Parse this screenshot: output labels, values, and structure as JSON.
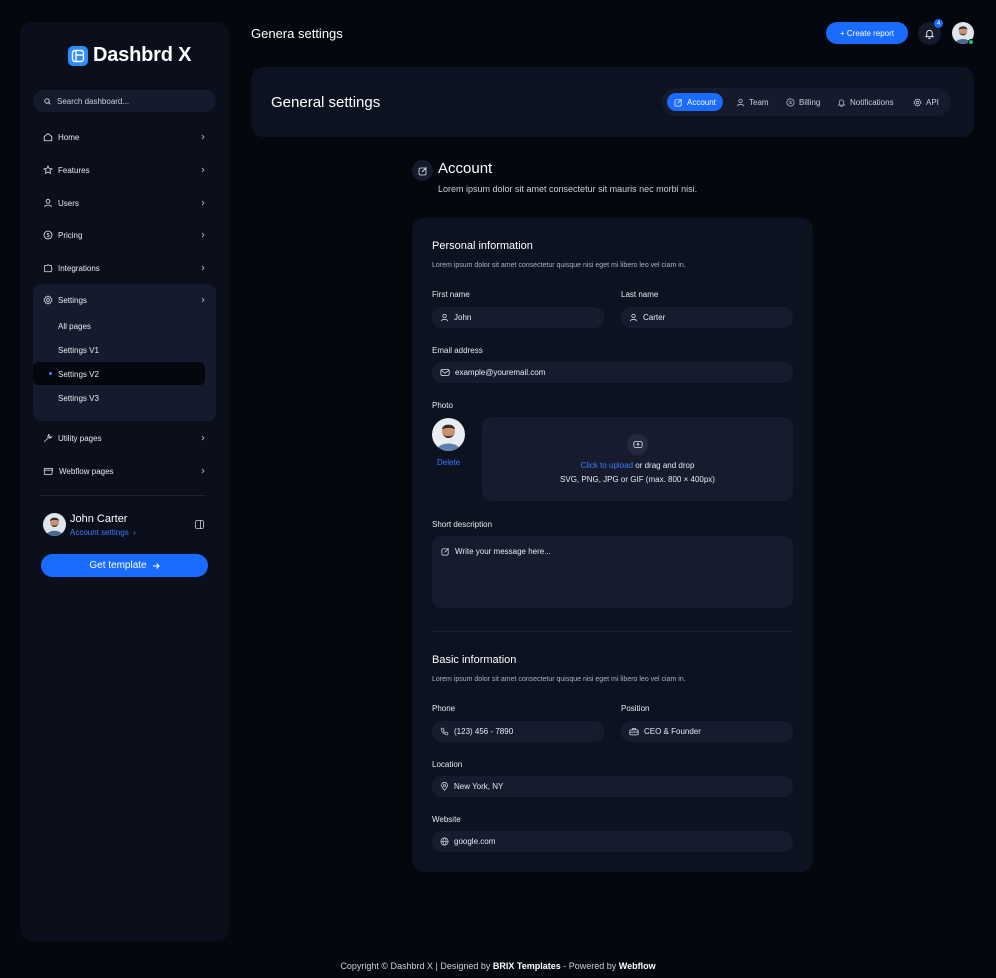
{
  "sidebar": {
    "logo_text": "Dashbrd X",
    "search_placeholder": "Search dashboard...",
    "items": [
      {
        "label": "Home",
        "icon": "home-icon"
      },
      {
        "label": "Features",
        "icon": "star-icon"
      },
      {
        "label": "Users",
        "icon": "user-icon"
      },
      {
        "label": "Pricing",
        "icon": "dollar-icon"
      },
      {
        "label": "Integrations",
        "icon": "puzzle-icon"
      },
      {
        "label": "Settings",
        "icon": "gear-icon"
      }
    ],
    "settings_sub": [
      "All pages",
      "Settings V1",
      "Settings V2",
      "Settings V3"
    ],
    "active_sub": "Settings V2",
    "more_items": [
      {
        "label": "Utility pages",
        "icon": "wrench-icon"
      },
      {
        "label": "Webflow pages",
        "icon": "browser-icon"
      }
    ],
    "profile": {
      "name": "John Carter",
      "link": "Account settings"
    },
    "cta": "Get template"
  },
  "topbar": {
    "title": "Genera settings",
    "create_label": "+ Create report",
    "notification_count": "4"
  },
  "header": {
    "title": "General settings",
    "tabs": [
      {
        "label": "Account",
        "icon": "edit-icon",
        "active": true
      },
      {
        "label": "Team",
        "icon": "user-icon",
        "active": false
      },
      {
        "label": "Billing",
        "icon": "dollar-icon",
        "active": false
      },
      {
        "label": "Notifications",
        "icon": "bell-icon",
        "active": false
      },
      {
        "label": "API",
        "icon": "gear-icon",
        "active": false
      }
    ]
  },
  "account": {
    "title": "Account",
    "description": "Lorem ipsum dolor sit amet consectetur sit mauris nec morbi nisi."
  },
  "personal": {
    "title": "Personal information",
    "description": "Lorem ipsum dolor sit amet consectetur quisque nisi eget mi libero leo vel ciam in.",
    "first_name_label": "First name",
    "first_name_value": "John",
    "last_name_label": "Last name",
    "last_name_value": "Carter",
    "email_label": "Email address",
    "email_placeholder": "example@youremail.com",
    "photo_label": "Photo",
    "delete_label": "Delete",
    "upload_link": "Click to upload",
    "upload_rest": " or drag and drop",
    "upload_hint": "SVG, PNG, JPG or GIF (max. 800 × 400px)",
    "short_desc_label": "Short description",
    "short_desc_placeholder": "Write your message here..."
  },
  "basic": {
    "title": "Basic information",
    "description": "Lorem ipsum dolor sit amet consectetur quisque nisi eget mi libero leo vel ciam in.",
    "phone_label": "Phone",
    "phone_value": "(123) 456 - 7890",
    "position_label": "Position",
    "position_value": "CEO  & Founder",
    "location_label": "Location",
    "location_value": "New York, NY",
    "website_label": "Website",
    "website_value": "google.com"
  },
  "footer": {
    "prefix": "Copyright © Dashbrd X | Designed by ",
    "brix": "BRIX Templates",
    "mid": " - Powered by ",
    "webflow": "Webflow"
  },
  "colors": {
    "accent": "#1a6bff",
    "background": "#05070f",
    "card": "#0d1220",
    "field": "#161c2d"
  }
}
